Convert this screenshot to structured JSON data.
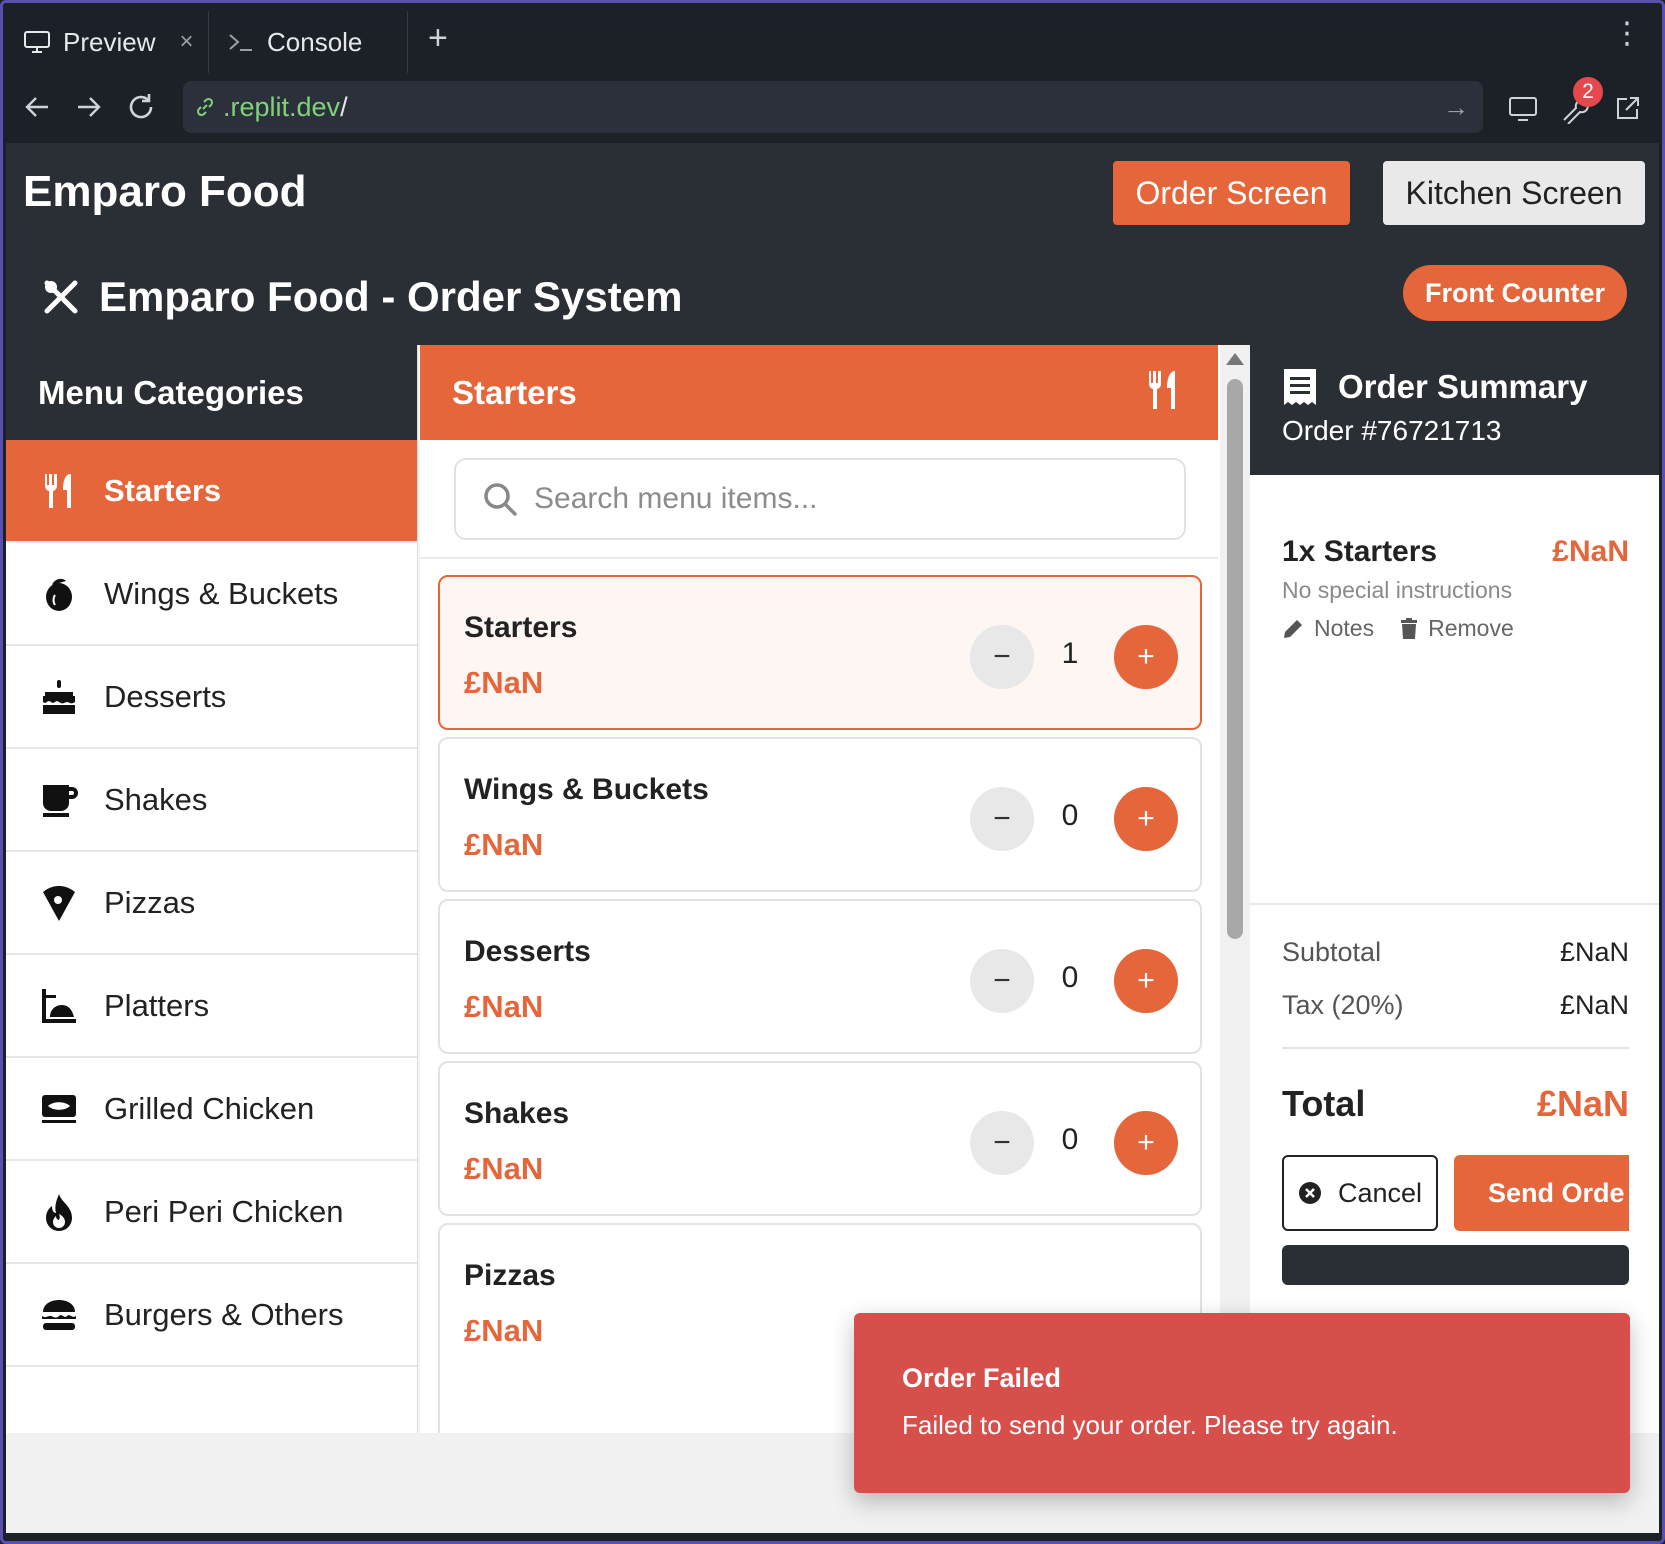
{
  "browser": {
    "tabs": [
      {
        "label": "Preview",
        "icon": "monitor-icon"
      },
      {
        "label": "Console",
        "icon": "terminal-icon"
      }
    ],
    "tab_close": "×",
    "new_tab": "+",
    "url_domain": ".replit.dev",
    "url_path": "/",
    "notification_count": "2"
  },
  "app": {
    "brand": "Emparo Food",
    "nav": {
      "order_screen": "Order Screen",
      "kitchen_screen": "Kitchen Screen"
    },
    "system_title": "Emparo Food - Order System",
    "location_button": "Front Counter",
    "accent_color": "#e4663a"
  },
  "categories": {
    "title": "Menu Categories",
    "items": [
      {
        "label": "Starters",
        "icon": "utensils-icon",
        "active": true
      },
      {
        "label": "Wings & Buckets",
        "icon": "drumstick-icon"
      },
      {
        "label": "Desserts",
        "icon": "cake-icon"
      },
      {
        "label": "Shakes",
        "icon": "mug-icon"
      },
      {
        "label": "Pizzas",
        "icon": "pizza-slice-icon"
      },
      {
        "label": "Platters",
        "icon": "platter-icon"
      },
      {
        "label": "Grilled Chicken",
        "icon": "grill-icon"
      },
      {
        "label": "Peri Peri Chicken",
        "icon": "fire-icon"
      },
      {
        "label": "Burgers & Others",
        "icon": "burger-icon"
      }
    ]
  },
  "menu": {
    "title": "Starters",
    "search_placeholder": "Search menu items...",
    "items": [
      {
        "name": "Starters",
        "price": "£NaN",
        "qty": "1",
        "selected": true
      },
      {
        "name": "Wings & Buckets",
        "price": "£NaN",
        "qty": "0"
      },
      {
        "name": "Desserts",
        "price": "£NaN",
        "qty": "0"
      },
      {
        "name": "Shakes",
        "price": "£NaN",
        "qty": "0"
      },
      {
        "name": "Pizzas",
        "price": "£NaN"
      }
    ],
    "minus": "−",
    "plus": "+"
  },
  "summary": {
    "title": "Order Summary",
    "order_number": "Order #76721713",
    "line": {
      "name": "1x Starters",
      "price": "£NaN",
      "note": "No special instructions",
      "notes_action": "Notes",
      "remove_action": "Remove"
    },
    "subtotal_label": "Subtotal",
    "subtotal": "£NaN",
    "tax_label": "Tax (20%)",
    "tax": "£NaN",
    "total_label": "Total",
    "total": "£NaN",
    "cancel": "Cancel",
    "send": "Send Orde"
  },
  "toast": {
    "title": "Order Failed",
    "message": "Failed to send your order. Please try again.",
    "color": "#d64f4b"
  }
}
